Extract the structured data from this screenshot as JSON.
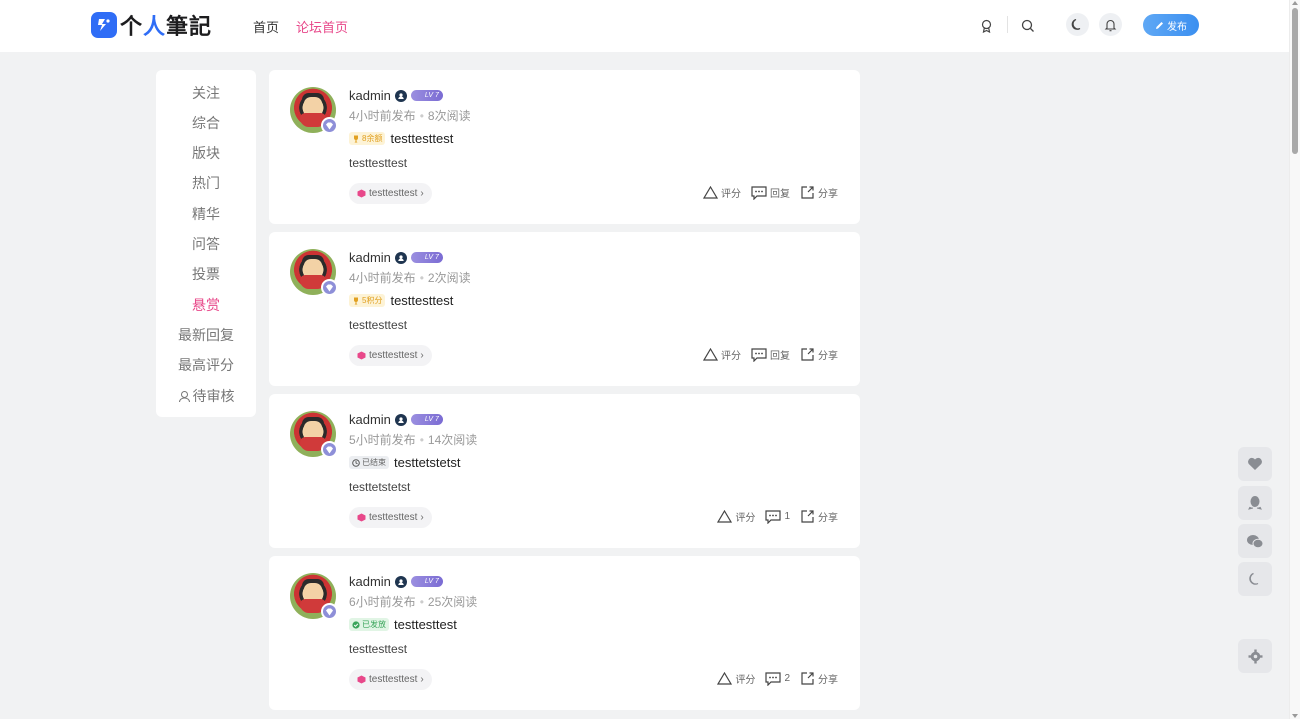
{
  "header": {
    "logo_text_a": "个",
    "logo_text_b": "人",
    "logo_text_c": "筆記",
    "nav": [
      {
        "label": "首页",
        "active": false
      },
      {
        "label": "论坛首页",
        "active": true
      }
    ],
    "publish_label": "发布",
    "icons": [
      "badge-icon",
      "search-icon",
      "moon-icon",
      "bell-icon"
    ]
  },
  "sidebar": {
    "items": [
      {
        "label": "关注",
        "active": false
      },
      {
        "label": "综合",
        "active": false
      },
      {
        "label": "版块",
        "active": false
      },
      {
        "label": "热门",
        "active": false
      },
      {
        "label": "精华",
        "active": false
      },
      {
        "label": "问答",
        "active": false
      },
      {
        "label": "投票",
        "active": false
      },
      {
        "label": "悬赏",
        "active": true
      },
      {
        "label": "最新回复",
        "active": false
      },
      {
        "label": "最高评分",
        "active": false
      },
      {
        "label": "待审核",
        "active": false,
        "icon": "user-icon"
      }
    ]
  },
  "posts": [
    {
      "author": "kadmin",
      "level": "LV 7",
      "time": "4小时前发布",
      "views": "8次阅读",
      "tag": {
        "type": "gold",
        "label": "8余额"
      },
      "title": "testtesttest",
      "excerpt": "testtesttest",
      "topic": "testtesttest",
      "actions": {
        "rate": "评分",
        "reply": "回复",
        "share": "分享"
      }
    },
    {
      "author": "kadmin",
      "level": "LV 7",
      "time": "4小时前发布",
      "views": "2次阅读",
      "tag": {
        "type": "gold",
        "label": "5积分"
      },
      "title": "testtesttest",
      "excerpt": "testtesttest",
      "topic": "testtesttest",
      "actions": {
        "rate": "评分",
        "reply": "回复",
        "share": "分享"
      }
    },
    {
      "author": "kadmin",
      "level": "LV 7",
      "time": "5小时前发布",
      "views": "14次阅读",
      "tag": {
        "type": "gray",
        "label": "已结束"
      },
      "title": "testtetstetst",
      "excerpt": "testtetstetst",
      "topic": "testtesttest",
      "actions": {
        "rate": "评分",
        "reply": "1",
        "share": "分享"
      }
    },
    {
      "author": "kadmin",
      "level": "LV 7",
      "time": "6小时前发布",
      "views": "25次阅读",
      "tag": {
        "type": "green",
        "label": "已发放"
      },
      "title": "testtesttest",
      "excerpt": "testtesttest",
      "topic": "testtesttest",
      "actions": {
        "rate": "评分",
        "reply": "2",
        "share": "分享"
      }
    }
  ],
  "floating": [
    "heart-icon",
    "qq-icon",
    "wechat-icon",
    "moon-icon",
    "settings-icon"
  ],
  "colors": {
    "accent": "#e8488a",
    "brand": "#2f6df6",
    "publish": "#3b8ff0"
  }
}
